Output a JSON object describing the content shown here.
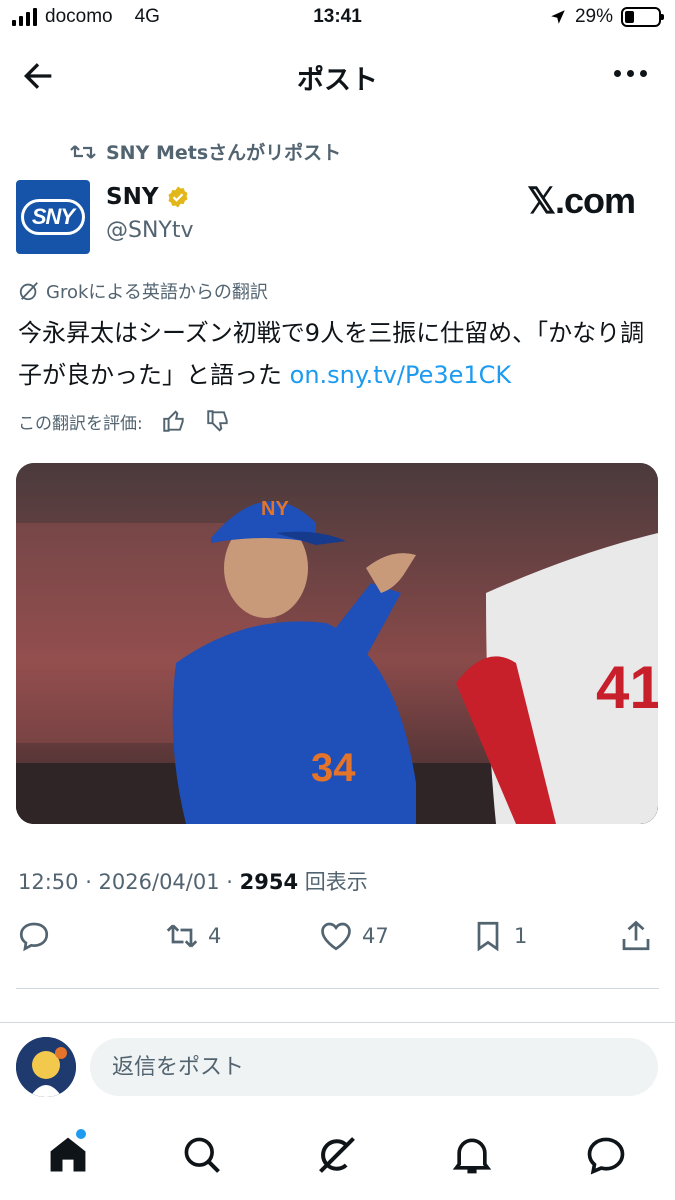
{
  "status_bar": {
    "carrier": "docomo",
    "network": "4G",
    "time": "13:41",
    "battery": "29%",
    "battery_level": 0.29
  },
  "header": {
    "title": "ポスト"
  },
  "post": {
    "repost_label": "SNY Metsさんがリポスト",
    "author_name": "SNY",
    "author_handle": "@SNYtv",
    "avatar_text": "SNY",
    "site_label": "𝕏.com",
    "translation_label": "Grokによる英語からの翻訳",
    "text": "今永昇太はシーズン初戦で9人を三振に仕留め、「かなり調子が良かった」と語った ",
    "link": "on.sny.tv/Pe3e1CK",
    "rate_label": "この翻訳を評価:",
    "meta_time": "12:50 · 2026/04/01 · ",
    "meta_views": "2954",
    "meta_views_label": "回表示"
  },
  "actions": {
    "reply_count": "",
    "repost_count": "4",
    "like_count": "47",
    "bookmark_count": "1"
  },
  "reply": {
    "placeholder": "返信をポスト"
  },
  "colors": {
    "accent": "#1d9bf0",
    "muted": "#536471",
    "sny_blue": "#1554a8",
    "verified_gold": "#e2b719"
  }
}
